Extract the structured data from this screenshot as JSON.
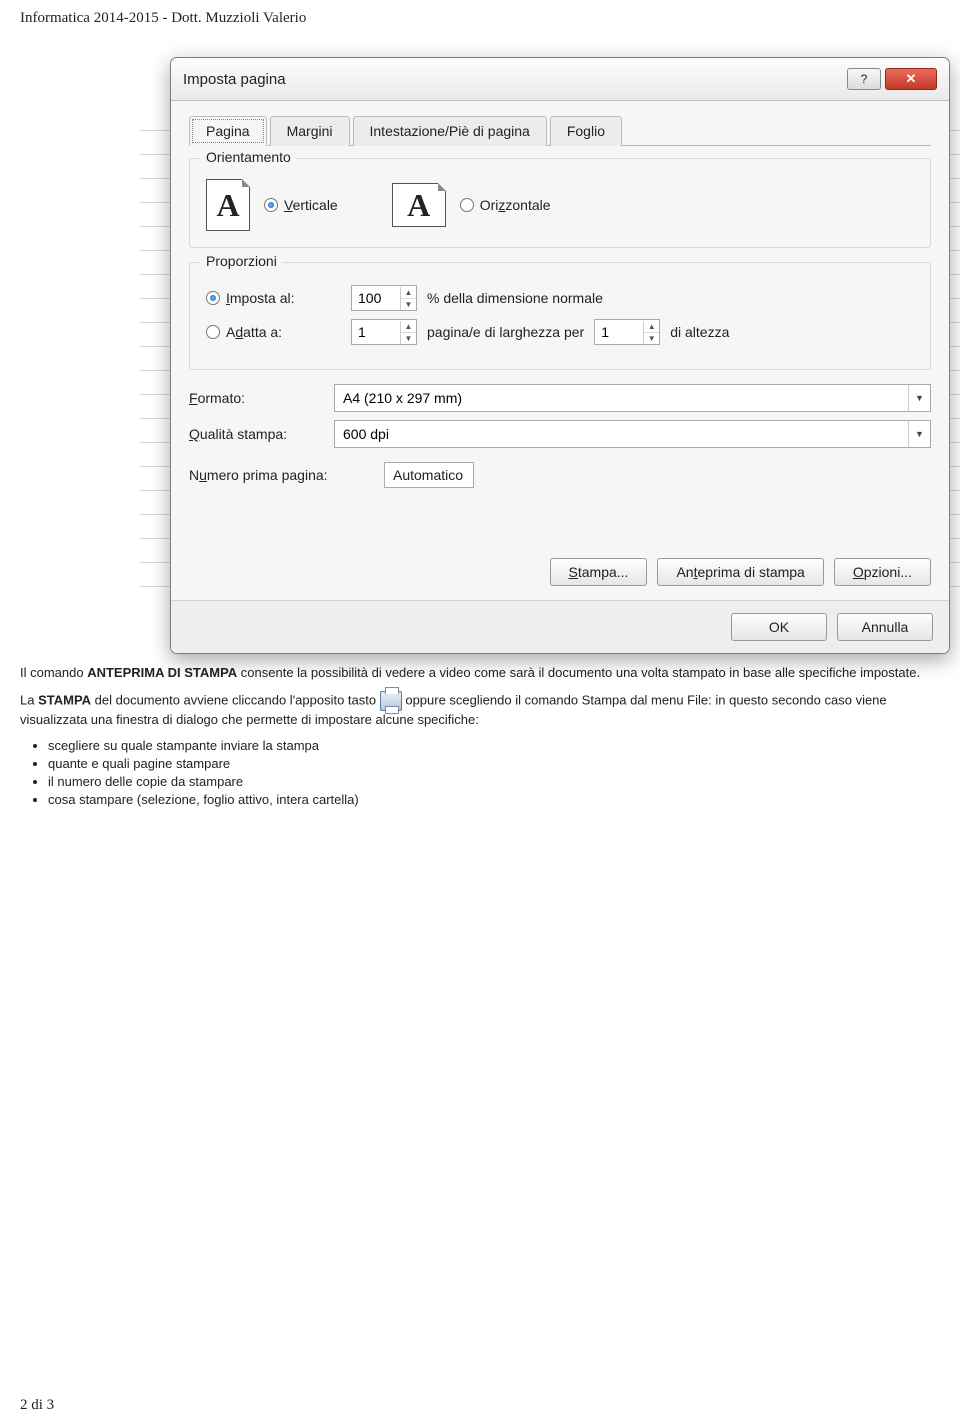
{
  "header": "Informatica 2014-2015 - Dott. Muzzioli Valerio",
  "footer": "2 di 3",
  "dialog": {
    "title": "Imposta pagina",
    "tabs": [
      "Pagina",
      "Margini",
      "Intestazione/Piè di pagina",
      "Foglio"
    ],
    "orientation": {
      "legend": "Orientamento",
      "vertical": "Verticale",
      "horizontal": "Orizzontale"
    },
    "scaling": {
      "legend": "Proporzioni",
      "adjust_label": "Imposta al:",
      "adjust_value": "100",
      "adjust_suffix": "% della dimensione normale",
      "fit_label": "Adatta a:",
      "fit_wide_value": "1",
      "fit_wide_suffix": "pagina/e di larghezza per",
      "fit_tall_value": "1",
      "fit_tall_suffix": "di altezza"
    },
    "paper": {
      "size_label": "Formato:",
      "size_value": "A4 (210 x 297 mm)",
      "quality_label": "Qualità stampa:",
      "quality_value": "600 dpi",
      "firstpage_label": "Numero prima pagina:",
      "firstpage_value": "Automatico"
    },
    "buttons": {
      "print": "Stampa...",
      "preview": "Anteprima di stampa",
      "options": "Opzioni...",
      "ok": "OK",
      "cancel": "Annulla"
    }
  },
  "text": {
    "p1a": "Il comando ",
    "p1b": "ANTEPRIMA DI STAMPA",
    "p1c": " consente la possibilità di vedere a video come sarà il documento una volta stampato in base alle specifiche impostate.",
    "p2a": "La ",
    "p2b": "STAMPA",
    "p2c": " del documento avviene cliccando l'apposito tasto ",
    "p2d": " oppure scegliendo il comando Stampa dal menu File: in questo secondo caso viene visualizzata una finestra di dialogo che permette di impostare alcune specifiche:",
    "bullets": [
      "scegliere su quale stampante inviare la stampa",
      "quante e quali pagine stampare",
      "il numero delle copie da stampare",
      "cosa stampare (selezione, foglio attivo, intera cartella)"
    ]
  }
}
